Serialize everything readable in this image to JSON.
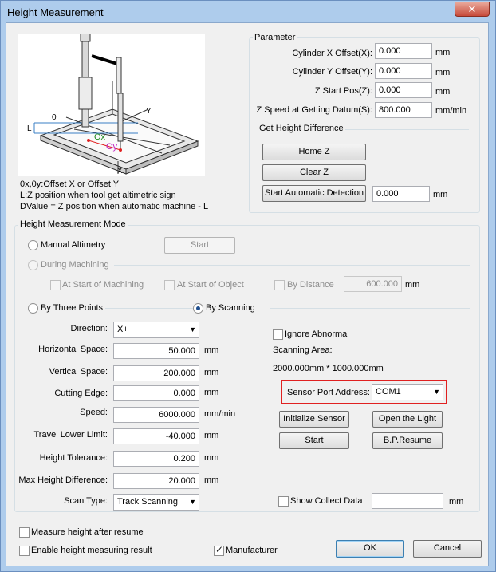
{
  "window": {
    "title": "Height Measurement",
    "close_glyph": "✕"
  },
  "diagram": {
    "label_0": "0",
    "label_l": "L",
    "label_ox": "Ox",
    "label_oy": "Oy",
    "label_x": "X",
    "label_y": "Y",
    "notes": [
      "0x,0y:Offset X or Offset Y",
      "L:Z position when tool get altimetric sign",
      "DValue = Z position when automatic machine - L"
    ]
  },
  "parameter": {
    "legend": "Parameter",
    "fields": [
      {
        "label": "Cylinder X Offset(X):",
        "value": "0.000",
        "unit": "mm"
      },
      {
        "label": "Cylinder Y Offset(Y):",
        "value": "0.000",
        "unit": "mm"
      },
      {
        "label": "Z Start Pos(Z):",
        "value": "0.000",
        "unit": "mm"
      },
      {
        "label": "Z Speed at Getting Datum(S):",
        "value": "800.000",
        "unit": "mm/min"
      }
    ],
    "get_height_legend": "Get Height Difference",
    "home_z": "Home Z",
    "clear_z": "Clear Z",
    "start_detection": "Start Automatic Detection",
    "detection_value": "0.000",
    "detection_unit": "mm"
  },
  "mode": {
    "legend": "Height Measurement Mode",
    "manual": "Manual Altimetry",
    "manual_start": "Start",
    "during_machining": "During Machining",
    "at_start_machining": "At Start of Machining",
    "at_start_object": "At Start of Object",
    "by_distance": "By Distance",
    "distance_value": "600.000",
    "distance_unit": "mm",
    "three_points": "By Three Points",
    "by_scanning": "By Scanning",
    "selected": "By Scanning"
  },
  "scan": {
    "fields": [
      {
        "label": "Horizontal Space:",
        "value": "50.000",
        "unit": "mm"
      },
      {
        "label": "Vertical Space:",
        "value": "200.000",
        "unit": "mm"
      },
      {
        "label": "Cutting Edge:",
        "value": "0.000",
        "unit": "mm"
      },
      {
        "label": "Speed:",
        "value": "6000.000",
        "unit": "mm/min"
      },
      {
        "label": "Travel Lower Limit:",
        "value": "-40.000",
        "unit": "mm"
      },
      {
        "label": "Height Tolerance:",
        "value": "0.200",
        "unit": "mm"
      },
      {
        "label": "Max Height Difference:",
        "value": "20.000",
        "unit": "mm"
      }
    ],
    "direction_label": "Direction:",
    "direction_value": "X+",
    "scan_type_label": "Scan Type:",
    "scan_type_value": "Track Scanning",
    "ignore_abnormal": "Ignore Abnormal",
    "scanning_area_label": "Scanning Area:",
    "scanning_area_value": "2000.000mm * 1000.000mm",
    "sensor_port_label": "Sensor Port Address:",
    "sensor_port_value": "COM1",
    "initialize_sensor": "Initialize Sensor",
    "open_light": "Open the Light",
    "start": "Start",
    "bp_resume": "B.P.Resume",
    "show_collect": "Show Collect Data",
    "collect_value": "",
    "collect_unit": "mm"
  },
  "footer": {
    "measure_after_resume": "Measure height after resume",
    "enable_result": "Enable height measuring result",
    "manufacturer": "Manufacturer",
    "manufacturer_checked": true,
    "ok": "OK",
    "cancel": "Cancel"
  },
  "colors": {
    "highlight": "#e02020",
    "titlebar": "#aeccec",
    "close": "#c74a3a"
  }
}
